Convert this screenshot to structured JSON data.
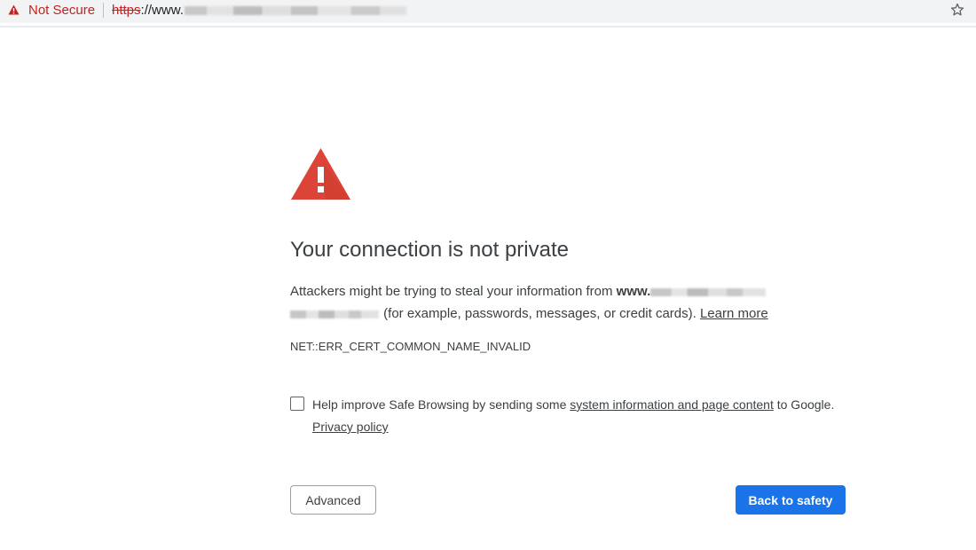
{
  "browser": {
    "security_label": "Not Secure",
    "url_scheme": "https",
    "url_visible_prefix": "://www.",
    "url_rest": "[blurred]",
    "colors": {
      "insecure": "#c5221f",
      "omnibox_bg": "#f1f3f4"
    }
  },
  "interstitial": {
    "heading": "Your connection is not private",
    "body_prefix": "Attackers might be trying to steal your information from ",
    "domain_visible": "www.",
    "domain_rest": "[blurred]",
    "body_suffix": " (for example, passwords, messages, or credit cards). ",
    "learn_more": "Learn more",
    "error_code": "NET::ERR_CERT_COMMON_NAME_INVALID",
    "safe_browsing": {
      "checked": false,
      "text_prefix": "Help improve Safe Browsing by sending some ",
      "link": "system information and page content",
      "text_suffix": " to Google.",
      "privacy_link": "Privacy policy"
    },
    "buttons": {
      "advanced": "Advanced",
      "back_to_safety": "Back to safety"
    },
    "colors": {
      "warning_red": "#db4437",
      "primary_blue": "#1a73e8",
      "text": "#3c4043"
    }
  }
}
